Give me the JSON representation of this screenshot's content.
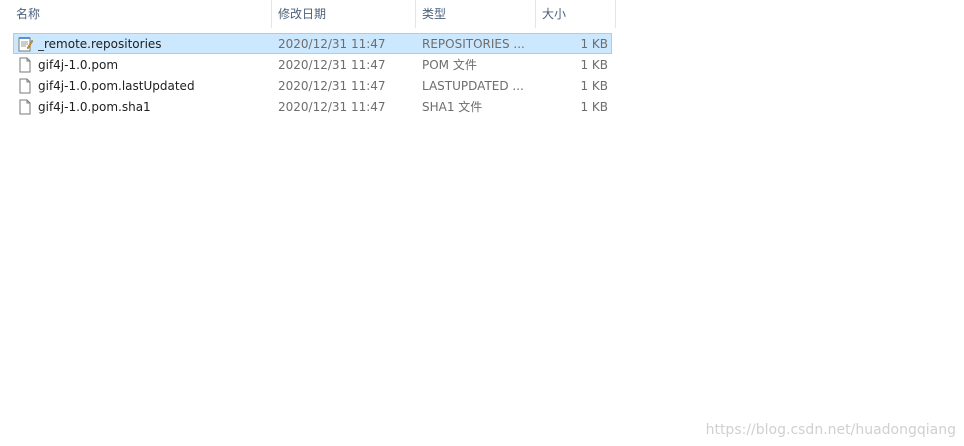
{
  "columns": {
    "name": "名称",
    "date": "修改日期",
    "type": "类型",
    "size": "大小"
  },
  "sort_indicator": "^",
  "files": [
    {
      "name": "_remote.repositories",
      "date": "2020/12/31 11:47",
      "type": "REPOSITORIES ...",
      "size": "1 KB",
      "icon": "notepad-file-icon",
      "selected": true
    },
    {
      "name": "gif4j-1.0.pom",
      "date": "2020/12/31 11:47",
      "type": "POM 文件",
      "size": "1 KB",
      "icon": "blank-file-icon",
      "selected": false
    },
    {
      "name": "gif4j-1.0.pom.lastUpdated",
      "date": "2020/12/31 11:47",
      "type": "LASTUPDATED ...",
      "size": "1 KB",
      "icon": "blank-file-icon",
      "selected": false
    },
    {
      "name": "gif4j-1.0.pom.sha1",
      "date": "2020/12/31 11:47",
      "type": "SHA1 文件",
      "size": "1 KB",
      "icon": "blank-file-icon",
      "selected": false
    }
  ],
  "watermark": "https://blog.csdn.net/huadongqiang",
  "colors": {
    "selection_bg": "#cce8ff",
    "selection_border": "#99d1ff",
    "header_text": "#4c607a"
  }
}
